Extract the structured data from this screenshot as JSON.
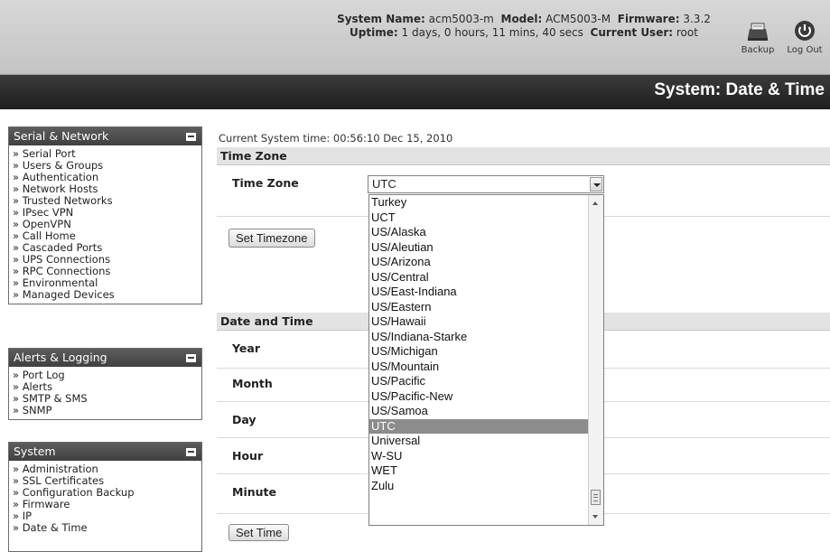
{
  "header": {
    "system_name_label": "System Name:",
    "system_name": "acm5003-m",
    "model_label": "Model:",
    "model": "ACM5003-M",
    "firmware_label": "Firmware:",
    "firmware": "3.3.2",
    "uptime_label": "Uptime:",
    "uptime": "1 days, 0 hours, 11 mins, 40 secs",
    "user_label": "Current User:",
    "user": "root",
    "backup_label": "Backup",
    "logout_label": "Log Out"
  },
  "page_title": "System: Date & Time",
  "sidebar": {
    "serial": {
      "title": "Serial & Network",
      "items": [
        "» Serial Port",
        "» Users & Groups",
        "» Authentication",
        "» Network Hosts",
        "» Trusted Networks",
        "» IPsec VPN",
        "» OpenVPN",
        "» Call Home",
        "» Cascaded Ports",
        "» UPS Connections",
        "» RPC Connections",
        "» Environmental",
        "» Managed Devices"
      ]
    },
    "alerts": {
      "title": "Alerts & Logging",
      "items": [
        "» Port Log",
        "» Alerts",
        "» SMTP & SMS",
        "» SNMP"
      ]
    },
    "system": {
      "title": "System",
      "items": [
        "» Administration",
        "» SSL Certificates",
        "» Configuration Backup",
        "» Firmware",
        "» IP",
        "» Date & Time"
      ]
    }
  },
  "main": {
    "current_time": "Current System time: 00:56:10 Dec 15, 2010",
    "tz_section": "Time Zone",
    "tz_label": "Time Zone",
    "tz_selected": "UTC",
    "set_tz_button": "Set Timezone",
    "dt_section": "Date and Time",
    "year_label": "Year",
    "month_label": "Month",
    "day_label": "Day",
    "hour_label": "Hour",
    "minute_label": "Minute",
    "set_time_button": "Set Time"
  },
  "tz_options": [
    "Turkey",
    "UCT",
    "US/Alaska",
    "US/Aleutian",
    "US/Arizona",
    "US/Central",
    "US/East-Indiana",
    "US/Eastern",
    "US/Hawaii",
    "US/Indiana-Starke",
    "US/Michigan",
    "US/Mountain",
    "US/Pacific",
    "US/Pacific-New",
    "US/Samoa",
    "UTC",
    "Universal",
    "W-SU",
    "WET",
    "Zulu"
  ],
  "tz_highlighted": "UTC"
}
